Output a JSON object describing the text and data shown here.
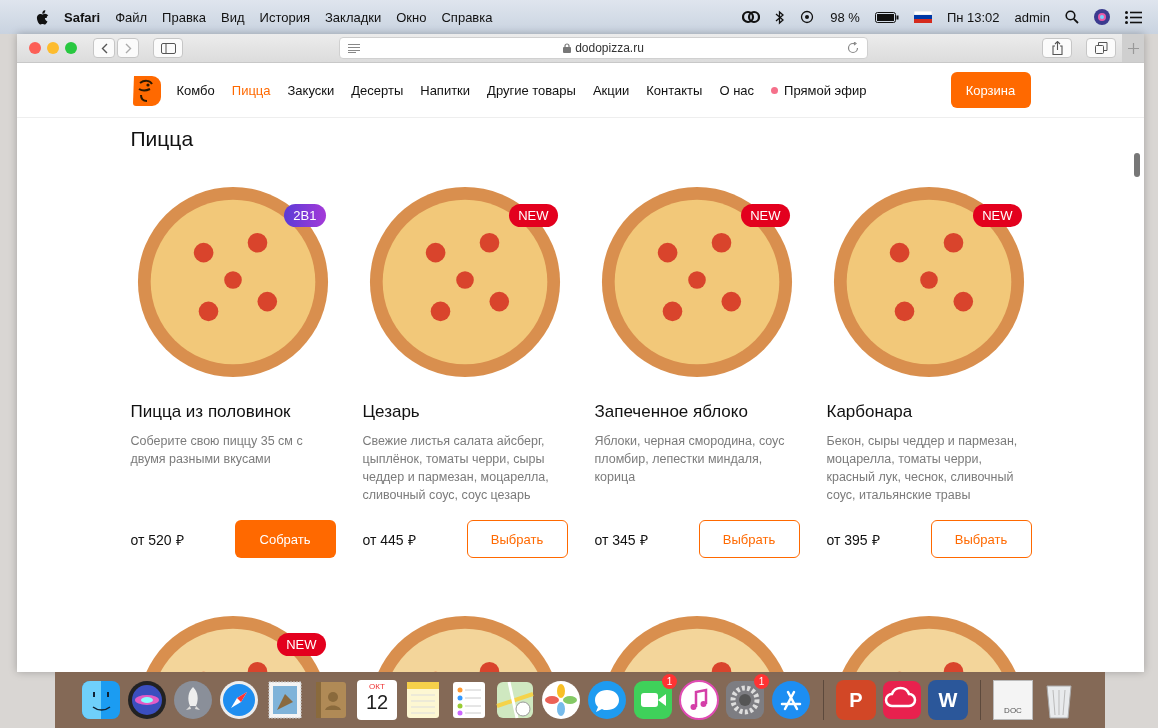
{
  "menubar": {
    "app": "Safari",
    "menus": [
      "Файл",
      "Правка",
      "Вид",
      "История",
      "Закладки",
      "Окно",
      "Справка"
    ],
    "battery": "98 %",
    "clock": "Пн 13:02",
    "user": "admin"
  },
  "browser": {
    "address": "dodopizza.ru"
  },
  "nav": {
    "items": [
      {
        "label": "Комбо",
        "kind": "link",
        "selected": false
      },
      {
        "label": "Пицца",
        "kind": "link",
        "selected": true
      },
      {
        "label": "Закуски",
        "kind": "link",
        "selected": false
      },
      {
        "label": "Десерты",
        "kind": "link",
        "selected": false
      },
      {
        "label": "Напитки",
        "kind": "link",
        "selected": false
      },
      {
        "label": "Другие товары",
        "kind": "link",
        "selected": false
      },
      {
        "label": "Акции",
        "kind": "link",
        "selected": false
      },
      {
        "label": "Контакты",
        "kind": "link",
        "selected": false
      },
      {
        "label": "О нас",
        "kind": "link",
        "selected": false
      },
      {
        "label": "Прямой эфир",
        "kind": "live",
        "selected": false
      }
    ],
    "cart_button": "Корзина"
  },
  "heading": "Пицца",
  "pizzas": [
    {
      "badge": {
        "kind": "combo",
        "text": "2В1"
      },
      "title": "Пицца из половинок",
      "description": "Соберите свою пиццу 35 см с двумя разными вкусами",
      "price": "от 520 ₽",
      "button": {
        "kind": "primary",
        "label": "Собрать"
      }
    },
    {
      "badge": {
        "kind": "new",
        "text": "NEW"
      },
      "title": "Цезарь",
      "description": "Свежие листья салата айсберг, цыплёнок, томаты черри, сыры чеддер и пармезан, моцарелла, сливочный соус, соус цезарь",
      "price": "от 445 ₽",
      "button": {
        "kind": "outline",
        "label": "Выбрать"
      }
    },
    {
      "badge": {
        "kind": "new",
        "text": "NEW"
      },
      "title": "Запеченное яблоко",
      "description": "Яблоки, черная смородина, соус пломбир, лепестки миндаля, корица",
      "price": "от 345 ₽",
      "button": {
        "kind": "outline",
        "label": "Выбрать"
      }
    },
    {
      "badge": {
        "kind": "new",
        "text": "NEW"
      },
      "title": "Карбонара",
      "description": "Бекон, сыры чеддер и пармезан, моцарелла, томаты черри, красный лук, чеснок, сливочный соус, итальянские травы",
      "price": "от 395 ₽",
      "button": {
        "kind": "outline",
        "label": "Выбрать"
      }
    }
  ],
  "pizzas_next_row": [
    {
      "kind": "badged",
      "badge": {
        "kind": "new",
        "text": "NEW"
      }
    },
    {
      "kind": "plain"
    },
    {
      "kind": "plain"
    },
    {
      "kind": "plain"
    }
  ],
  "dock": [
    {
      "kind": "finder"
    },
    {
      "kind": "siri"
    },
    {
      "kind": "rocket"
    },
    {
      "kind": "compass"
    },
    {
      "kind": "stamp"
    },
    {
      "kind": "book"
    },
    {
      "kind": "calendar",
      "month": "ОКТ",
      "day": "12"
    },
    {
      "kind": "notes"
    },
    {
      "kind": "reminders"
    },
    {
      "kind": "maps"
    },
    {
      "kind": "photos"
    },
    {
      "kind": "messages"
    },
    {
      "kind": "facetime",
      "badge": "1"
    },
    {
      "kind": "music"
    },
    {
      "kind": "gear",
      "badge": "1"
    },
    {
      "kind": "appstore"
    },
    {
      "kind": "separator"
    },
    {
      "kind": "powerpoint",
      "glyph": "P"
    },
    {
      "kind": "cloud"
    },
    {
      "kind": "word",
      "glyph": "W"
    },
    {
      "kind": "separator"
    },
    {
      "kind": "document",
      "glyph": "DOC"
    },
    {
      "kind": "trash"
    }
  ]
}
